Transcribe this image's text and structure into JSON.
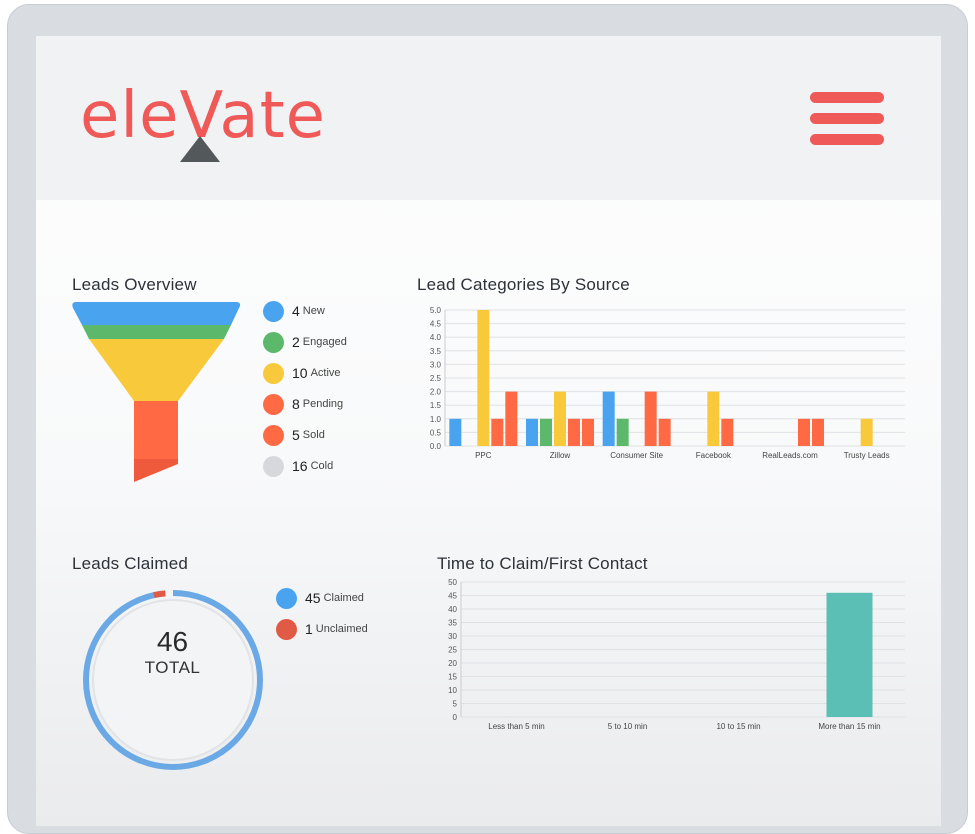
{
  "brand": {
    "logo_text": "eleVate",
    "accent": "#ef5a59",
    "dark": "#53585b"
  },
  "header": {
    "menu_icon": "hamburger-icon"
  },
  "leads_overview": {
    "title": "Leads Overview",
    "stages": [
      {
        "count": "4",
        "label": "New",
        "color": "#4aa3ef"
      },
      {
        "count": "2",
        "label": "Engaged",
        "color": "#5cb86a"
      },
      {
        "count": "10",
        "label": "Active",
        "color": "#f9c93c"
      },
      {
        "count": "8",
        "label": "Pending",
        "color": "#ff6a45"
      },
      {
        "count": "5",
        "label": "Sold",
        "color": "#ff6a45"
      },
      {
        "count": "16",
        "label": "Cold",
        "color": "#d6d8db"
      }
    ]
  },
  "leads_claimed": {
    "title": "Leads Claimed",
    "total": "46",
    "total_label": "TOTAL",
    "items": [
      {
        "count": "45",
        "label": "Claimed",
        "color": "#4aa3ef"
      },
      {
        "count": "1",
        "label": "Unclaimed",
        "color": "#e05a45"
      }
    ]
  },
  "chart_data": [
    {
      "type": "bar",
      "title": "Lead Categories By Source",
      "categories": [
        "PPC",
        "Zillow",
        "Consumer Site",
        "Facebook",
        "RealLeads.com",
        "Trusty Leads"
      ],
      "ylim": [
        0,
        5
      ],
      "yticks": [
        "0.0",
        "0.5",
        "1.0",
        "1.5",
        "2.0",
        "2.5",
        "3.0",
        "3.5",
        "4.0",
        "4.5",
        "5.0"
      ],
      "grid": true,
      "series": [
        {
          "color": "#4aa3ef",
          "values": [
            1,
            1,
            2,
            0,
            0,
            0
          ]
        },
        {
          "color": "#5cb86a",
          "values": [
            0,
            1,
            1,
            0,
            0,
            0
          ]
        },
        {
          "color": "#f9c93c",
          "values": [
            5,
            2,
            0,
            2,
            0,
            1
          ]
        },
        {
          "color": "#ff6a45",
          "values": [
            1,
            1,
            2,
            1,
            1,
            0
          ]
        },
        {
          "color": "#ff6a45",
          "values": [
            2,
            1,
            1,
            0,
            1,
            0
          ]
        }
      ]
    },
    {
      "type": "bar",
      "title": "Time to Claim/First Contact",
      "categories": [
        "Less than 5 min",
        "5 to 10 min",
        "10 to 15 min",
        "More than 15 min"
      ],
      "ylim": [
        0,
        50
      ],
      "yticks": [
        "0",
        "5",
        "10",
        "15",
        "20",
        "25",
        "30",
        "35",
        "40",
        "45",
        "50"
      ],
      "grid": true,
      "series": [
        {
          "color": "#5bbfb5",
          "values": [
            0,
            0,
            0,
            46
          ]
        }
      ]
    },
    {
      "type": "pie",
      "title": "Leads Claimed",
      "categories": [
        "Claimed",
        "Unclaimed"
      ],
      "values": [
        45,
        1
      ],
      "colors": [
        "#6aa9e6",
        "#e05a45"
      ]
    }
  ]
}
